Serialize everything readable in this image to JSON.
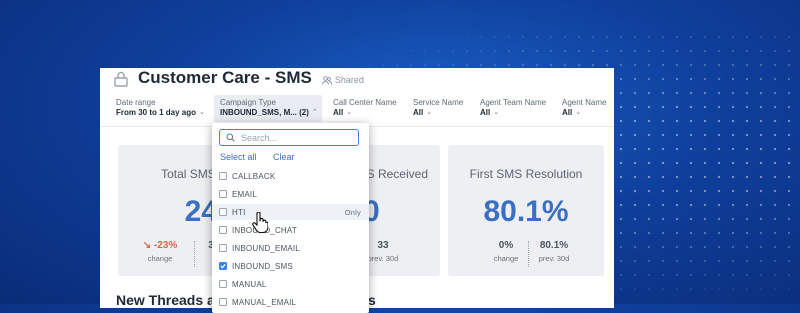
{
  "header": {
    "title": "Customer Care - SMS",
    "shared_label": "Shared"
  },
  "filters": [
    {
      "label": "Date range",
      "value": "From 30 to 1 day ago"
    },
    {
      "label": "Campaign Type",
      "value": "INBOUND_SMS, M... (2)"
    },
    {
      "label": "Call Center Name",
      "value": "All"
    },
    {
      "label": "Service Name",
      "value": "All"
    },
    {
      "label": "Agent Team Name",
      "value": "All"
    },
    {
      "label": "Agent Name",
      "value": "All"
    }
  ],
  "cards": [
    {
      "title": "Total SMS Th",
      "big": "24",
      "stat1_value": "-23%",
      "stat1_sub": "change",
      "stat2_value": "3"
    },
    {
      "title": "S Received",
      "big": "0",
      "stat2_value": "33",
      "stat2_sub": "prev. 30d"
    },
    {
      "title": "First SMS Resolution",
      "big": "80.1%",
      "stat1_value": "0%",
      "stat1_sub": "change",
      "stat2_value": "80.1%",
      "stat2_sub": "prev. 30d"
    }
  ],
  "section": {
    "title_left": "New Threads an",
    "title_right": "s"
  },
  "dropdown": {
    "search_placeholder": "Search...",
    "select_all": "Select all",
    "clear": "Clear",
    "only_label": "Only",
    "options": [
      {
        "label": "CALLBACK",
        "checked": false
      },
      {
        "label": "EMAIL",
        "checked": false
      },
      {
        "label": "HTI",
        "checked": false
      },
      {
        "label": "INBOUND_CHAT",
        "checked": false
      },
      {
        "label": "INBOUND_EMAIL",
        "checked": false
      },
      {
        "label": "INBOUND_SMS",
        "checked": true
      },
      {
        "label": "MANUAL",
        "checked": false
      },
      {
        "label": "MANUAL_EMAIL",
        "checked": false
      }
    ]
  },
  "colors": {
    "accent": "#3a6fc4",
    "negative": "#d9644a",
    "background": "#0f3f9c"
  }
}
